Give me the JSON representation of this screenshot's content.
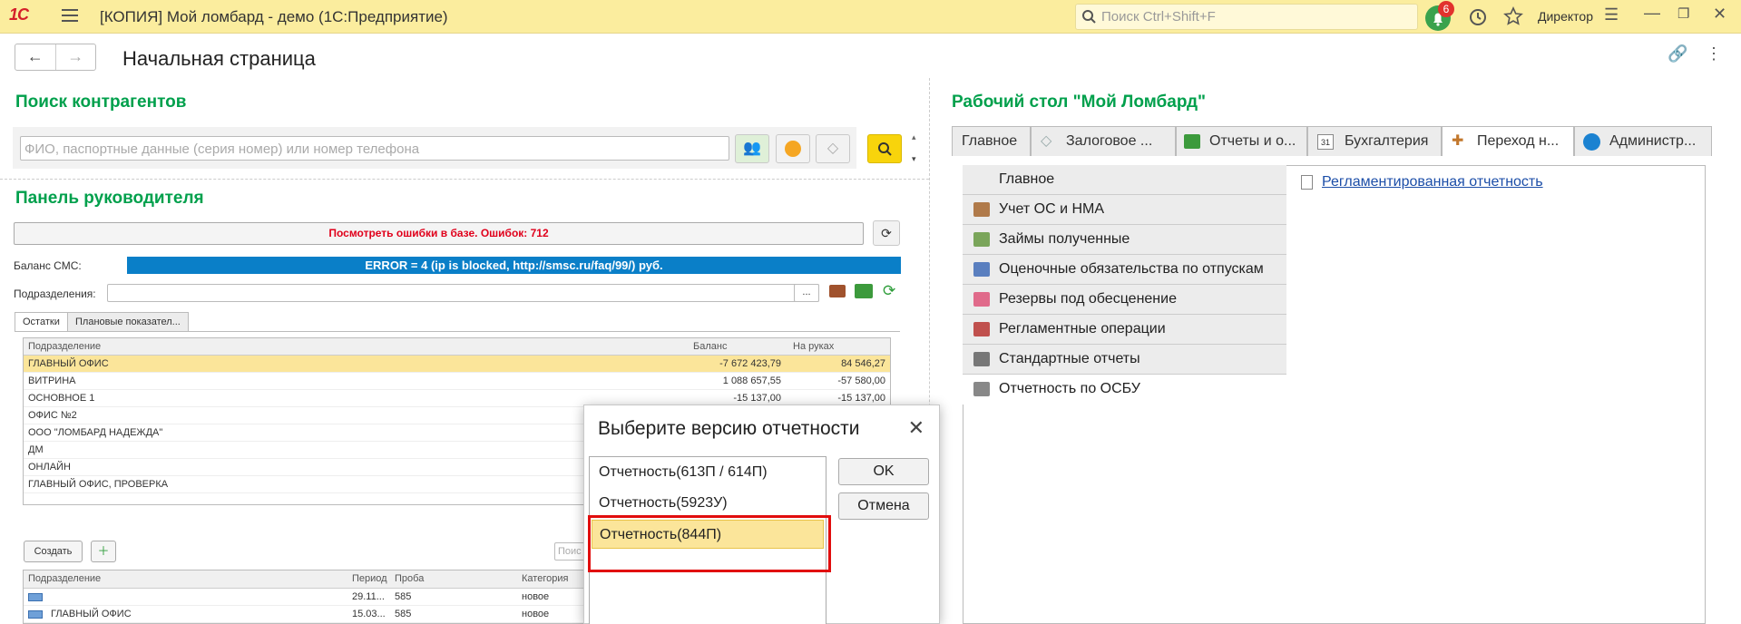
{
  "titlebar": {
    "logo": "1С",
    "title": "[КОПИЯ] Мой ломбард - демо  (1С:Предприятие)",
    "search_placeholder": "Поиск Ctrl+Shift+F",
    "notifications": "6",
    "user": "Директор"
  },
  "nav": {
    "page_title": "Начальная страница"
  },
  "search_section": {
    "heading": "Поиск контрагентов",
    "placeholder": "ФИО, паспортные данные (серия номер) или номер телефона"
  },
  "panel": {
    "heading": "Панель руководителя",
    "errors_button": "Посмотреть ошибки в базе. Ошибок: 712",
    "sms_label": "Баланс СМС:",
    "sms_value": "ERROR = 4 (ip is blocked, http://smsc.ru/faq/99/) руб.",
    "division_label": "Подразделения:",
    "division_value": "",
    "ellipsis": "...",
    "tabs": [
      "Остатки",
      "Плановые показател..."
    ],
    "table": {
      "columns": [
        "Подразделение",
        "Баланс",
        "На руках"
      ],
      "rows": [
        [
          "ГЛАВНЫЙ ОФИС",
          "-7 672 423,79",
          "84 546,27"
        ],
        [
          "ВИТРИНА",
          "1 088 657,55",
          "-57 580,00"
        ],
        [
          "ОСНОВНОЕ 1",
          "-15 137,00",
          "-15 137,00"
        ],
        [
          "ОФИС №2",
          "",
          ""
        ],
        [
          "ООО \"ЛОМБАРД НАДЕЖДА\"",
          "",
          ""
        ],
        [
          "ДМ",
          "",
          ""
        ],
        [
          "ОНЛАЙН",
          "",
          ""
        ],
        [
          "ГЛАВНЫЙ ОФИС, ПРОВЕРКА",
          "",
          ""
        ]
      ]
    },
    "create_button": "Создать",
    "search_stub": "Поис",
    "table2": {
      "columns": [
        "Подразделение",
        "Период",
        "Проба",
        "Категория"
      ],
      "rows": [
        [
          "",
          "29.11...",
          "585",
          "новое"
        ],
        [
          "ГЛАВНЫЙ ОФИС",
          "15.03...",
          "585",
          "новое"
        ]
      ]
    }
  },
  "desktop": {
    "heading": "Рабочий стол \"Мой Ломбард\"",
    "tabs": [
      "Главное",
      "Залоговое ...",
      "Отчеты и о...",
      "Бухгалтерия",
      "Переход н...",
      "Администр..."
    ],
    "menu": [
      "Главное",
      "Учет ОС и НМА",
      "Займы полученные",
      "Оценочные обязательства по отпускам",
      "Резервы под обесценение",
      "Регламентные операции",
      "Стандартные отчеты",
      "Отчетность по ОСБУ"
    ],
    "link": "Регламентированная отчетность"
  },
  "dialog": {
    "title": "Выберите версию отчетности",
    "options": [
      "Отчетность(613П / 614П)",
      "Отчетность(5923У)",
      "Отчетность(844П)"
    ],
    "ok": "OK",
    "cancel": "Отмена"
  },
  "colors": {
    "titlebar": "#fbed9e",
    "accent_green": "#00a04c",
    "selection": "#fbe59a",
    "sms_bar": "#0a7fc8",
    "error_text": "#e0001b",
    "highlight_border": "#e10d0d"
  }
}
